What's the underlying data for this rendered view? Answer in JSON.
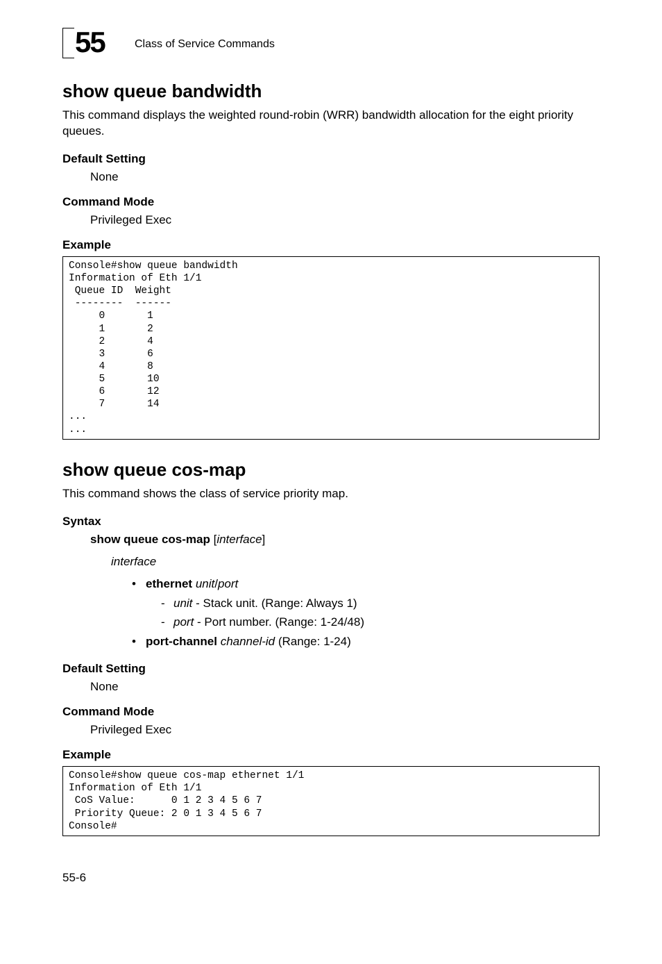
{
  "header": {
    "chapter_number": "55",
    "chapter_title": "Class of Service Commands"
  },
  "section1": {
    "heading": "show queue bandwidth",
    "intro": "This command displays the weighted round-robin (WRR) bandwidth allocation for the eight priority queues.",
    "default_setting_label": "Default Setting",
    "default_setting_value": "None",
    "command_mode_label": "Command Mode",
    "command_mode_value": "Privileged Exec",
    "example_label": "Example",
    "code": "Console#show queue bandwidth\nInformation of Eth 1/1\n Queue ID  Weight\n --------  ------\n     0       1\n     1       2\n     2       4\n     3       6\n     4       8\n     5       10\n     6       12\n     7       14\n...\n..."
  },
  "section2": {
    "heading": "show queue cos-map",
    "intro": "This command shows the class of service priority map.",
    "syntax_label": "Syntax",
    "syntax_cmd_bold": "show queue cos-map",
    "syntax_cmd_open": " [",
    "syntax_cmd_param": "interface",
    "syntax_cmd_close": "]",
    "param_name": "interface",
    "bullet1_bold": "ethernet",
    "bullet1_it1": "unit",
    "bullet1_sep": "/",
    "bullet1_it2": "port",
    "dash1_it": "unit",
    "dash1_rest": " - Stack unit. (Range: Always 1)",
    "dash2_it": "port",
    "dash2_rest": " - Port number. (Range: 1-24/48)",
    "bullet2_bold": "port-channel",
    "bullet2_it": "channel-id",
    "bullet2_rest": " (Range: 1-24)",
    "default_setting_label": "Default Setting",
    "default_setting_value": "None",
    "command_mode_label": "Command Mode",
    "command_mode_value": "Privileged Exec",
    "example_label": "Example",
    "code": "Console#show queue cos-map ethernet 1/1\nInformation of Eth 1/1\n CoS Value:      0 1 2 3 4 5 6 7\n Priority Queue: 2 0 1 3 4 5 6 7\nConsole#"
  },
  "footer": {
    "page_num": "55-6"
  }
}
